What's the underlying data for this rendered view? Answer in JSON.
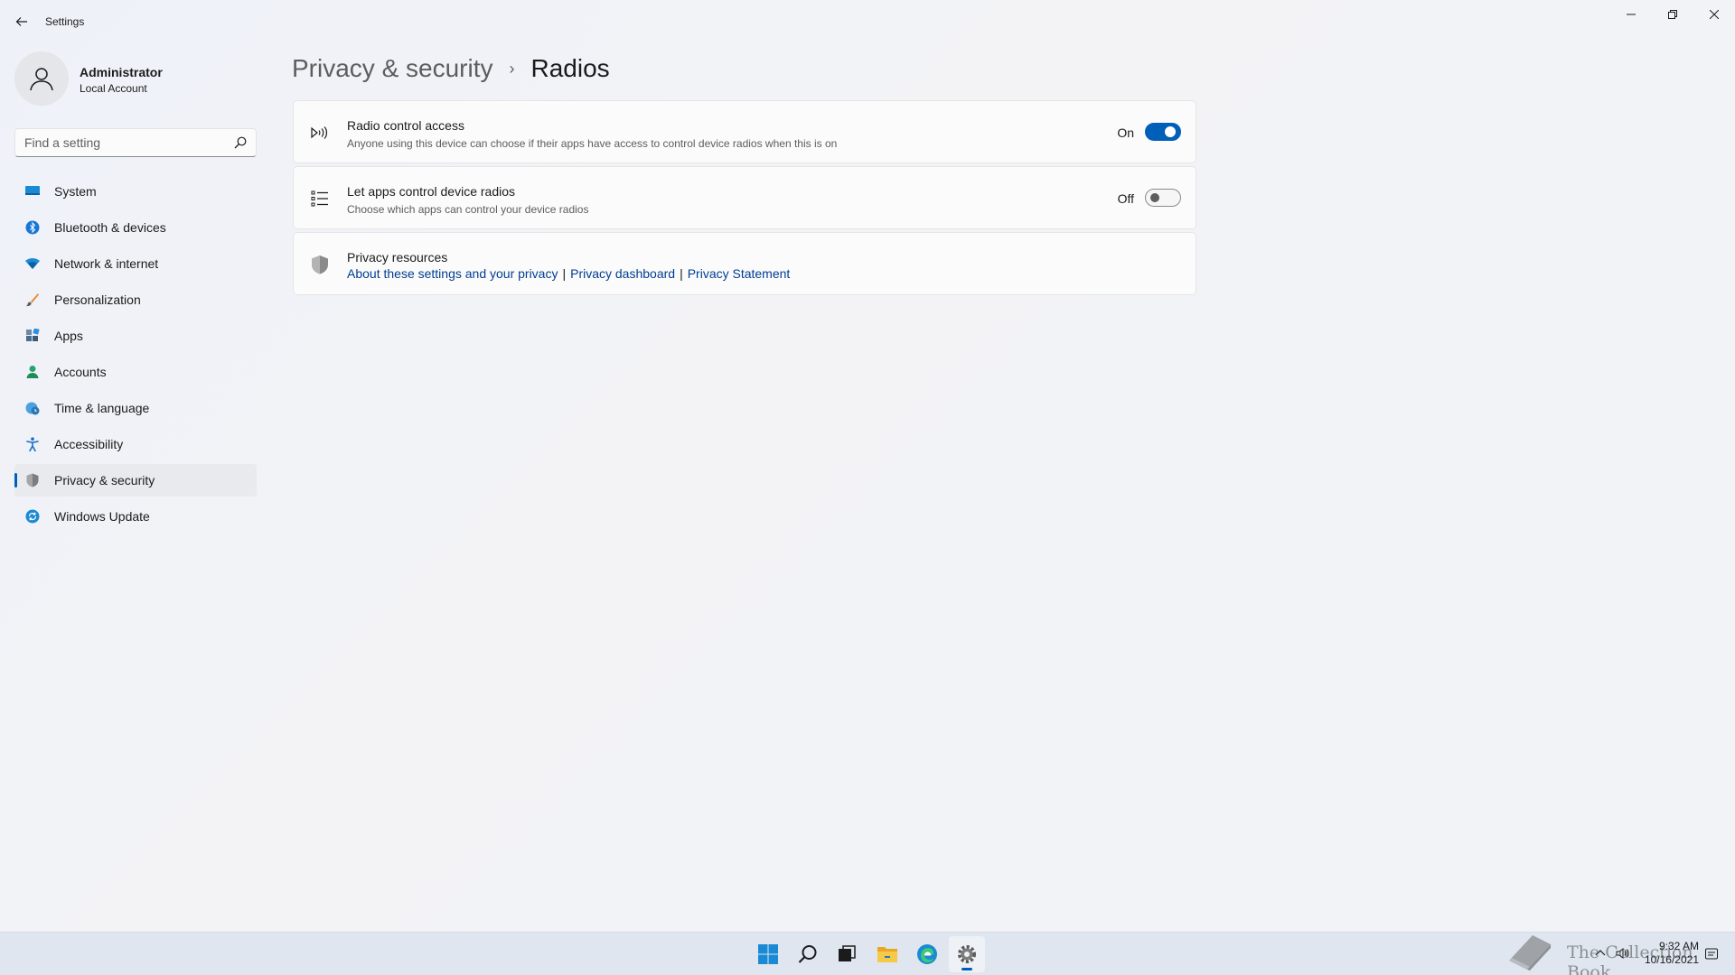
{
  "window": {
    "app_title": "Settings"
  },
  "profile": {
    "name": "Administrator",
    "account_type": "Local Account"
  },
  "search": {
    "placeholder": "Find a setting"
  },
  "sidebar": {
    "items": [
      {
        "label": "System",
        "icon": "system-icon",
        "active": false
      },
      {
        "label": "Bluetooth & devices",
        "icon": "bluetooth-icon",
        "active": false
      },
      {
        "label": "Network & internet",
        "icon": "wifi-icon",
        "active": false
      },
      {
        "label": "Personalization",
        "icon": "brush-icon",
        "active": false
      },
      {
        "label": "Apps",
        "icon": "apps-icon",
        "active": false
      },
      {
        "label": "Accounts",
        "icon": "accounts-icon",
        "active": false
      },
      {
        "label": "Time & language",
        "icon": "globe-clock-icon",
        "active": false
      },
      {
        "label": "Accessibility",
        "icon": "accessibility-icon",
        "active": false
      },
      {
        "label": "Privacy & security",
        "icon": "shield-icon",
        "active": true
      },
      {
        "label": "Windows Update",
        "icon": "update-icon",
        "active": false
      }
    ]
  },
  "breadcrumb": {
    "parent": "Privacy & security",
    "separator": "›",
    "current": "Radios"
  },
  "settings": {
    "radio_control": {
      "title": "Radio control access",
      "description": "Anyone using this device can choose if their apps have access to control device radios when this is on",
      "state_label": "On",
      "enabled": true
    },
    "let_apps": {
      "title": "Let apps control device radios",
      "description": "Choose which apps can control your device radios",
      "state_label": "Off",
      "enabled": false
    },
    "privacy_resources": {
      "title": "Privacy resources",
      "links": [
        "About these settings and your privacy",
        "Privacy dashboard",
        "Privacy Statement"
      ],
      "link_separator": "|"
    }
  },
  "taskbar": {
    "apps": [
      "start-icon",
      "search-icon",
      "task-view-icon",
      "file-explorer-icon",
      "edge-icon",
      "settings-icon"
    ],
    "clock_time": "9:32 AM",
    "clock_date": "10/16/2021"
  },
  "watermark": {
    "text": "The Collection Book"
  },
  "colors": {
    "accent": "#005fb8",
    "link": "#003e92",
    "background": "#f3f3f3",
    "card": "#fbfbfb"
  }
}
